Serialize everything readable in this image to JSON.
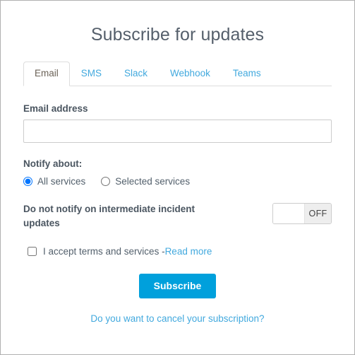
{
  "header": {
    "title": "Subscribe for updates"
  },
  "tabs": [
    {
      "label": "Email",
      "active": true
    },
    {
      "label": "SMS",
      "active": false
    },
    {
      "label": "Slack",
      "active": false
    },
    {
      "label": "Webhook",
      "active": false
    },
    {
      "label": "Teams",
      "active": false
    }
  ],
  "form": {
    "email": {
      "label": "Email address",
      "value": "",
      "placeholder": ""
    },
    "notify": {
      "label": "Notify about:",
      "options": [
        {
          "label": "All services",
          "selected": true
        },
        {
          "label": "Selected services",
          "selected": false
        }
      ]
    },
    "intermediate": {
      "label": "Do not notify on intermediate incident updates",
      "toggle_state": "OFF",
      "toggle_on": false
    },
    "terms": {
      "checked": false,
      "text": "I accept terms and services - ",
      "link_label": "Read more"
    },
    "submit_label": "Subscribe",
    "cancel_label": "Do you want to cancel your subscription?"
  },
  "colors": {
    "accent": "#00a0dc",
    "link": "#42a9de",
    "title": "#555f6b",
    "label": "#4a5560",
    "border": "#cccccc",
    "page_border": "#b0b0b0",
    "toggle_track": "#eeeeee"
  }
}
